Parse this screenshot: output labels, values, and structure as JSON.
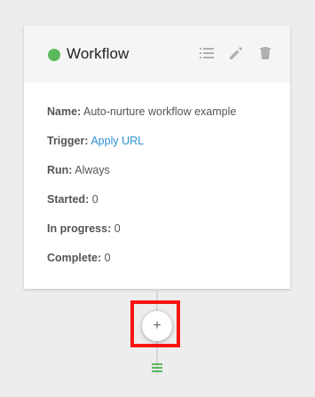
{
  "card": {
    "title": "Workflow",
    "status_color": "#5cb85c",
    "header_icons": [
      "list-icon",
      "pencil-icon",
      "trash-icon"
    ],
    "fields": {
      "name": {
        "label": "Name:",
        "value": "Auto-nurture workflow example"
      },
      "trigger": {
        "label": "Trigger:",
        "value": "Apply URL"
      },
      "run": {
        "label": "Run:",
        "value": "Always"
      },
      "started": {
        "label": "Started:",
        "value": "0"
      },
      "in_progress": {
        "label": "In progress:",
        "value": "0"
      },
      "complete": {
        "label": "Complete:",
        "value": "0"
      }
    }
  },
  "add_step": {
    "symbol": "+",
    "highlight_color": "#ff1212"
  },
  "bottom_icon": "drag-handle-icon",
  "colors": {
    "link": "#2e8fcf",
    "connector": "#d5d5dc",
    "drag_handle": "#5cb85c"
  }
}
